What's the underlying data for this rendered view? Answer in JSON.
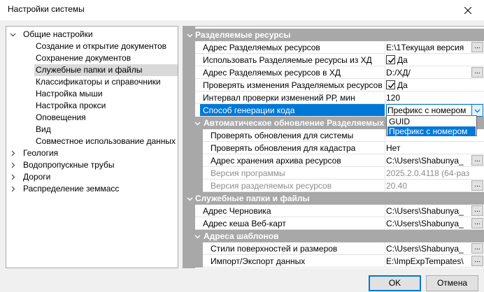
{
  "window": {
    "title": "Настройки системы"
  },
  "tree": {
    "items": [
      {
        "label": "Общие настройки",
        "expanded": true
      },
      {
        "label": "Создание и открытие документов"
      },
      {
        "label": "Сохранение документов"
      },
      {
        "label": "Служебные папки и файлы",
        "selected": true
      },
      {
        "label": "Классификаторы и справочники"
      },
      {
        "label": "Настройка мыши"
      },
      {
        "label": "Настройка прокси"
      },
      {
        "label": "Оповещения"
      },
      {
        "label": "Вид"
      },
      {
        "label": "Совместное использование данных"
      },
      {
        "label": "Геология",
        "expanded": false
      },
      {
        "label": "Водопропускные трубы",
        "expanded": false
      },
      {
        "label": "Дороги",
        "expanded": false
      },
      {
        "label": "Распределение земмасс",
        "expanded": false
      }
    ]
  },
  "grid": {
    "shared": {
      "title": "Разделяемые ресурсы",
      "address_label": "Адрес Разделяемых ресурсов",
      "address_value": "E:\\1Текущая версия",
      "use_from_db_label": "Использовать Разделяемые ресурсы из ХД",
      "use_from_db_value": "Да",
      "db_address_label": "Адрес Разделяемых ресурсов в ХД",
      "db_address_value": "D:/ХД/",
      "check_changes_label": "Проверять изменения Разделяемых ресурсов",
      "check_changes_value": "Да",
      "interval_label": "Интервал проверки изменений РР, мин",
      "interval_value": "120",
      "codegen_label": "Способ генерации кода",
      "codegen_value": "Префикс с номером"
    },
    "auto_update": {
      "title": "Автоматическое обновление Разделяемых р",
      "check_system_label": "Проверять обновления для системы",
      "check_cadastre_label": "Проверять обновления для кадастра",
      "check_cadastre_value": "Нет",
      "archive_label": "Адрес хранения архива ресурсов",
      "archive_value": "C:\\Users\\Shabunya_",
      "program_version_label": "Версия программы",
      "program_version_value": "2025.2.0.4118 (64-раз",
      "shared_version_label": "Версия разделяемых ресурсов",
      "shared_version_value": "20.40"
    },
    "service": {
      "title": "Служебные папки и файлы",
      "draft_label": "Адрес Черновика",
      "draft_value": "C:\\Users\\Shabunya_",
      "web_cache_label": "Адрес кеша Веб-карт",
      "web_cache_value": "C:\\Users\\Shabunya_"
    },
    "templates": {
      "title": "Адреса шаблонов",
      "styles_label": "Стили поверхностей и размеров",
      "styles_value": "C:\\Users\\Shabunya_",
      "import_label": "Импорт/Экспорт данных",
      "import_value": "E:\\ImpExpTempates\\"
    },
    "ellipsis": "..."
  },
  "dropdown": {
    "options": [
      "GUID",
      "Префикс с номером"
    ],
    "highlighted": 1
  },
  "buttons": {
    "ok": "OK",
    "cancel": "Отмена"
  },
  "colors": {
    "accent": "#0078d7",
    "category": "#a8a8a8"
  }
}
